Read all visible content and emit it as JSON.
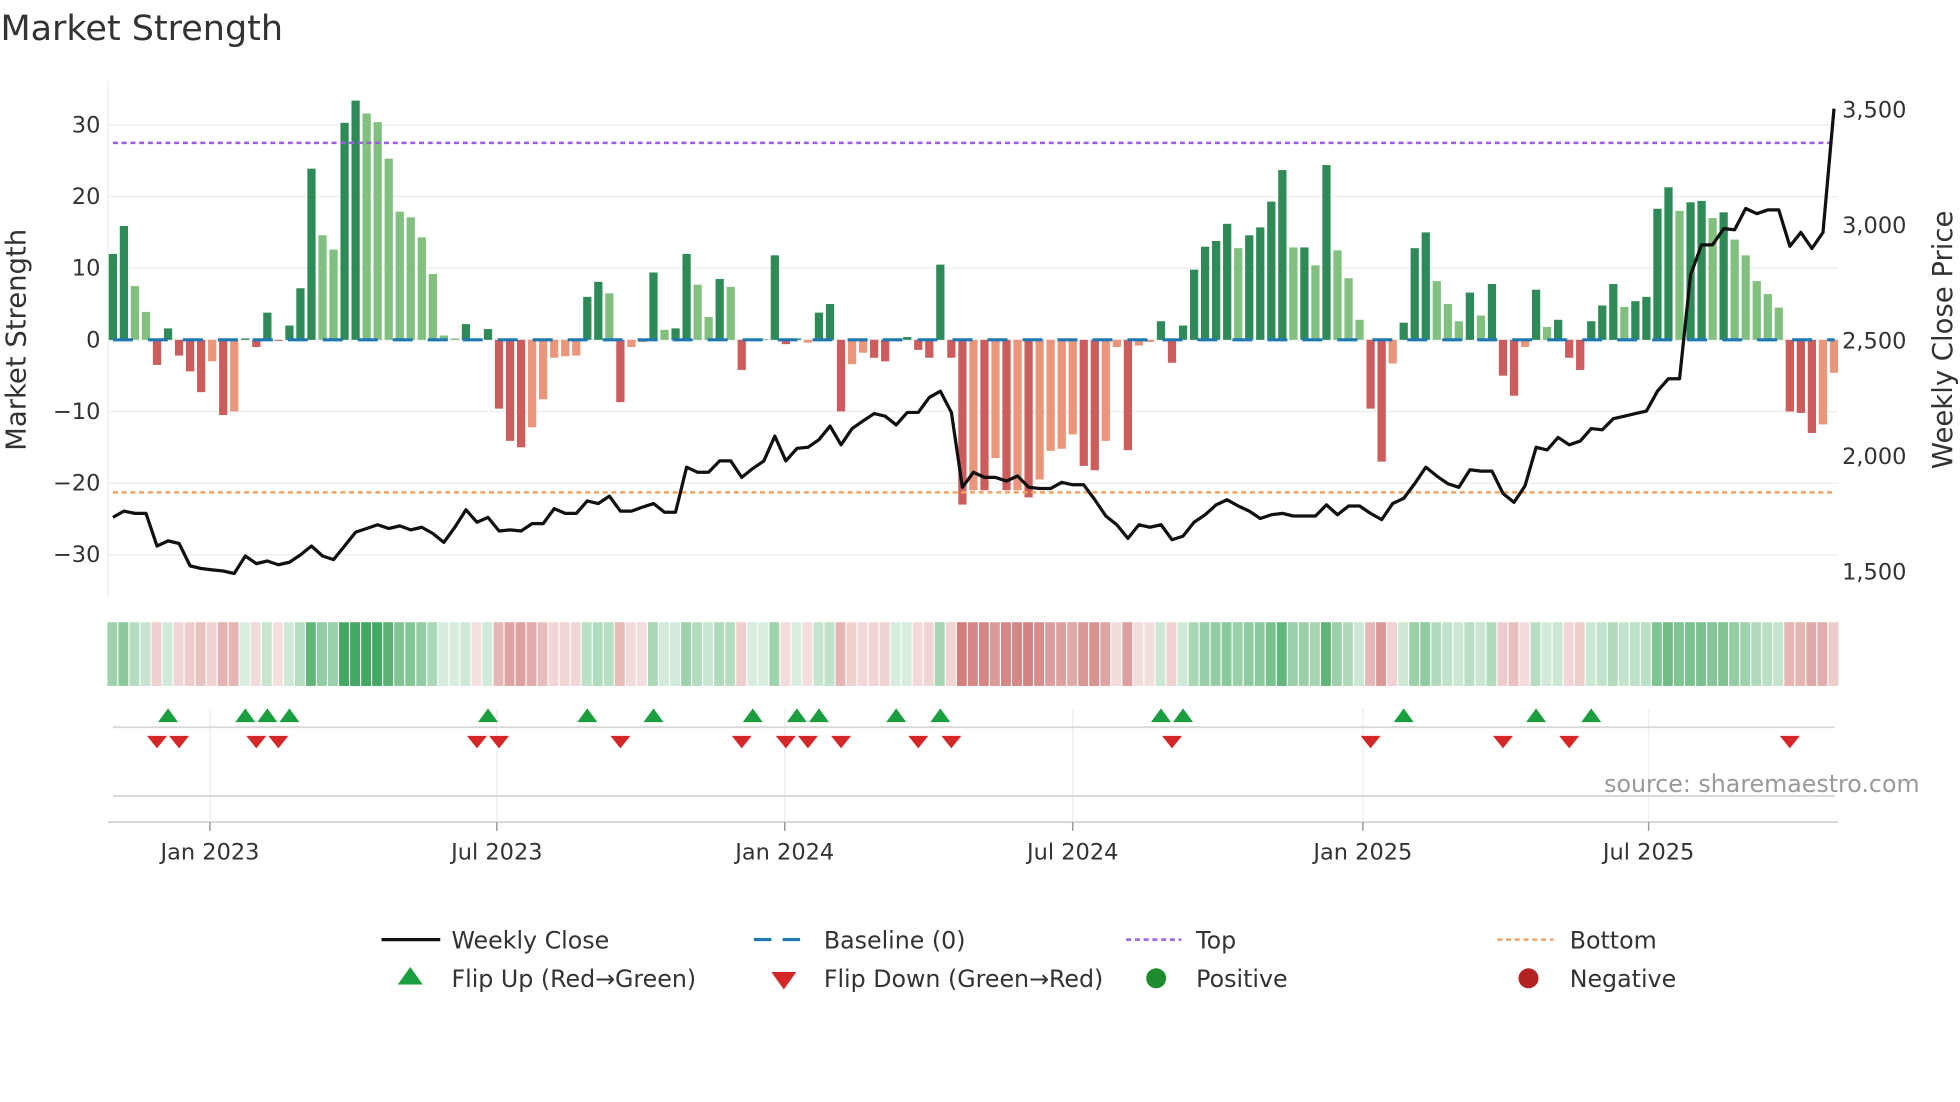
{
  "title": "Market Strength",
  "source": "source: sharemaestro.com",
  "colors": {
    "dark_green": "#2e8b57",
    "light_green": "#81c07f",
    "red": "#cd5c5c",
    "salmon": "#e9967a",
    "baseline": "#1f77b4",
    "top": "#9b5de5",
    "bottom": "#f4a261",
    "line": "#111111",
    "flip_up": "#1a9e3f",
    "flip_down": "#d62728",
    "positive": "#1e8c2e",
    "negative": "#b22222"
  },
  "legend": {
    "weekly_close": "Weekly Close",
    "baseline": "Baseline (0)",
    "top": "Top",
    "bottom": "Bottom",
    "flip_up": "Flip Up (Red→Green)",
    "flip_down": "Flip Down (Green→Red)",
    "positive": "Positive",
    "negative": "Negative"
  },
  "chart_data": {
    "type": "bar",
    "title": "Market Strength",
    "ylabel": "Market Strength",
    "ylabel_right": "Weekly Close Price",
    "ylim": [
      -35,
      36
    ],
    "ylim_right": [
      1390,
      3570
    ],
    "y_ticks": [
      30,
      20,
      10,
      0,
      -10,
      -20,
      -30
    ],
    "y_tick_labels": [
      "30",
      "20",
      "10",
      "0",
      "−10",
      "−20",
      "−30"
    ],
    "y_right_ticks": [
      3500,
      3000,
      2500,
      2000,
      1500
    ],
    "y_right_tick_labels": [
      "3,500",
      "3,000",
      "2,500",
      "2,000",
      "1,500"
    ],
    "x_ticks": [
      {
        "label": "Jan 2023",
        "week": 8.8
      },
      {
        "label": "Jul 2023",
        "week": 34.8
      },
      {
        "label": "Jan 2024",
        "week": 60.9
      },
      {
        "label": "Jul 2024",
        "week": 87.0
      },
      {
        "label": "Jan 2025",
        "week": 113.3
      },
      {
        "label": "Jul 2025",
        "week": 139.2
      }
    ],
    "top_level": 27.5,
    "bottom_level": -21.3,
    "grid": true,
    "legend_position": "bottom",
    "strength": [
      12,
      15.9,
      7.5,
      3.9,
      -3.5,
      1.6,
      -2.2,
      -4.4,
      -7.3,
      -3,
      -10.5,
      -10,
      0.2,
      -1,
      3.8,
      -0.1,
      2,
      7.2,
      23.9,
      14.6,
      12.6,
      30.3,
      33.4,
      31.6,
      30.4,
      25.3,
      17.9,
      17.1,
      14.3,
      9.2,
      0.6,
      0.2,
      2.2,
      -0.1,
      1.5,
      -9.6,
      -14.1,
      -15,
      -12.2,
      -8.3,
      -2.5,
      -2.3,
      -2.2,
      6,
      8.1,
      6.5,
      -8.7,
      -1,
      -0.3,
      9.4,
      1.4,
      1.6,
      12,
      7.7,
      3.2,
      8.5,
      7.4,
      -4.2,
      0.1,
      0.1,
      11.8,
      -0.6,
      0.2,
      -0.4,
      3.8,
      5,
      -10,
      -3.4,
      -1.8,
      -2.5,
      -3,
      0.2,
      0.4,
      -1.4,
      -2.5,
      10.5,
      -2.5,
      -23,
      -21,
      -21,
      -16.5,
      -21,
      -21,
      -22,
      -19.5,
      -15.5,
      -15.2,
      -13.2,
      -17.6,
      -18.2,
      -14.1,
      -1,
      -15.4,
      -0.8,
      -0.3,
      2.6,
      -3.2,
      2,
      9.8,
      13,
      13.8,
      16.2,
      12.8,
      14.6,
      15.7,
      19.3,
      23.7,
      12.9,
      12.9,
      10.4,
      24.4,
      12.5,
      8.6,
      2.8,
      -9.6,
      -17,
      -3.3,
      2.4,
      12.8,
      15,
      8.2,
      5,
      2.6,
      6.6,
      3.4,
      7.8,
      -5,
      -7.8,
      -1,
      7,
      1.8,
      2.8,
      -2.5,
      -4.2,
      2.6,
      4.8,
      7.8,
      4.6,
      5.4,
      6,
      18.3,
      21.3,
      18,
      19.2,
      19.4,
      17,
      17.8,
      14,
      11.8,
      8.2,
      6.4,
      4.5,
      -10,
      -10.2,
      -13,
      -11.8,
      -4.6
    ],
    "strength_class": "GGggRGRRRrRrGRGRGGGggGGgggggggggGrGRRRrrrrrGGgRrrGgGGggGgRGgGRGrGGRrrRRGGRRGRRrRrRrRrrrrRRrrRrrGRGGGGGgGGGGgGgGgggRRrGGGgggGgGRRrGgGRRGGGgGGGGgGGgGgggggRRRrr",
    "weekly_close": [
      1732,
      1759,
      1749,
      1749,
      1608,
      1630,
      1619,
      1522,
      1511,
      1505,
      1500,
      1489,
      1565,
      1532,
      1543,
      1527,
      1538,
      1570,
      1608,
      1565,
      1549,
      1608,
      1668,
      1684,
      1700,
      1684,
      1695,
      1678,
      1689,
      1662,
      1624,
      1689,
      1765,
      1711,
      1732,
      1673,
      1678,
      1673,
      1705,
      1705,
      1770,
      1749,
      1749,
      1803,
      1792,
      1824,
      1759,
      1759,
      1776,
      1792,
      1754,
      1754,
      1949,
      1927,
      1927,
      1976,
      1976,
      1905,
      1943,
      1976,
      2084,
      1976,
      2030,
      2035,
      2068,
      2127,
      2046,
      2116,
      2149,
      2181,
      2170,
      2132,
      2186,
      2186,
      2251,
      2278,
      2186,
      1862,
      1927,
      1905,
      1905,
      1889,
      1911,
      1862,
      1857,
      1857,
      1884,
      1873,
      1873,
      1808,
      1738,
      1700,
      1641,
      1700,
      1689,
      1700,
      1635,
      1651,
      1711,
      1743,
      1786,
      1808,
      1781,
      1759,
      1727,
      1743,
      1749,
      1738,
      1738,
      1738,
      1786,
      1743,
      1781,
      1781,
      1749,
      1722,
      1792,
      1814,
      1878,
      1949,
      1911,
      1878,
      1862,
      1938,
      1932,
      1932,
      1835,
      1797,
      1868,
      2035,
      2024,
      2078,
      2046,
      2062,
      2116,
      2111,
      2159,
      2170,
      2181,
      2192,
      2278,
      2332,
      2332,
      2781,
      2911,
      2911,
      2981,
      2976,
      3068,
      3046,
      3062,
      3062,
      2905,
      2965,
      2895,
      2965,
      3500
    ],
    "flip_up_weeks": [
      5,
      12,
      14,
      16,
      34,
      43,
      49,
      58,
      62,
      64,
      71,
      75,
      95,
      97,
      117,
      129,
      134
    ],
    "flip_down_weeks": [
      4,
      6,
      13,
      15,
      33,
      35,
      46,
      57,
      61,
      63,
      66,
      73,
      76,
      96,
      114,
      126,
      132,
      152
    ]
  }
}
